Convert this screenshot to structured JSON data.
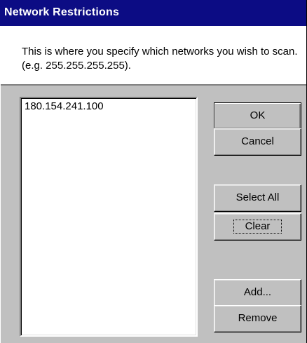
{
  "dialog": {
    "title": "Network Restrictions",
    "description": "This is where you specify which networks you wish to scan. (e.g. 255.255.255.255).",
    "networks": [
      "180.154.241.100"
    ],
    "buttons": {
      "ok": "OK",
      "cancel": "Cancel",
      "select_all": "Select All",
      "clear": "Clear",
      "add": "Add...",
      "remove": "Remove"
    },
    "colors": {
      "titlebar": "#0c0c84",
      "face": "#c0c0c0",
      "window": "#ffffff"
    }
  }
}
